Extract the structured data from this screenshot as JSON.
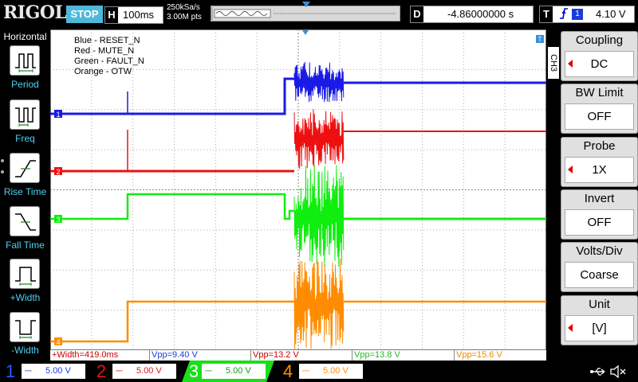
{
  "header": {
    "brand": "RIGOL",
    "run_state": "STOP",
    "timebase_label": "H",
    "timebase_value": "100ms",
    "sample_rate": "250kSa/s",
    "memory_depth": "3.00M pts",
    "delay_label": "D",
    "delay_value": "-4.86000000 s",
    "trigger_label": "T",
    "trigger_edge": "rising-edge-icon",
    "trigger_source": "1",
    "trigger_level": "4.10 V"
  },
  "left_menu": {
    "title": "Horizontal",
    "items": [
      {
        "label": "Period",
        "icon": "period-icon"
      },
      {
        "label": "Freq",
        "icon": "freq-icon"
      },
      {
        "label": "Rise Time",
        "icon": "rise-time-icon"
      },
      {
        "label": "Fall Time",
        "icon": "fall-time-icon"
      },
      {
        "label": "+Width",
        "icon": "pos-width-icon"
      },
      {
        "label": "-Width",
        "icon": "neg-width-icon"
      }
    ]
  },
  "legend": [
    "Blue - RESET_N",
    "Red - MUTE_N",
    "Green - FAULT_N",
    "Orange - OTW"
  ],
  "channel_markers": [
    "1",
    "2",
    "3",
    "4"
  ],
  "right_menu": {
    "channel_tag": "CH3",
    "items": [
      {
        "title": "Coupling",
        "value": "DC",
        "has_arrow": true
      },
      {
        "title": "BW Limit",
        "value": "OFF",
        "has_arrow": false
      },
      {
        "title": "Probe",
        "value": "1X",
        "has_arrow": true
      },
      {
        "title": "Invert",
        "value": "OFF",
        "has_arrow": false
      },
      {
        "title": "Volts/Div",
        "value": "Coarse",
        "has_arrow": false
      },
      {
        "title": "Unit",
        "value": "[V]",
        "has_arrow": true
      }
    ]
  },
  "measurements": [
    {
      "text": "+Width=419.0ms",
      "color": "#cc0000"
    },
    {
      "text": "Vpp=9.40 V",
      "color": "#1a3cd8"
    },
    {
      "text": "Vpp=13.2 V",
      "color": "#cc0000"
    },
    {
      "text": "Vpp=13.8 V",
      "color": "#22bb22"
    },
    {
      "text": "Vpp=15.6 V",
      "color": "#ee8800"
    }
  ],
  "channels": [
    {
      "num": "1",
      "scale": "5.00 V",
      "color": "#1a3cd8",
      "active": false
    },
    {
      "num": "2",
      "scale": "5.00 V",
      "color": "#e01818",
      "active": false
    },
    {
      "num": "3",
      "scale": "5.00 V",
      "color": "#18e018",
      "active": true
    },
    {
      "num": "4",
      "scale": "5.00 V",
      "color": "#ff9000",
      "active": false
    }
  ],
  "colors": {
    "blue": "#1a1ae6",
    "red": "#ee1010",
    "green": "#10ee10",
    "orange": "#ff8c00",
    "accent": "#4fb8d8"
  }
}
